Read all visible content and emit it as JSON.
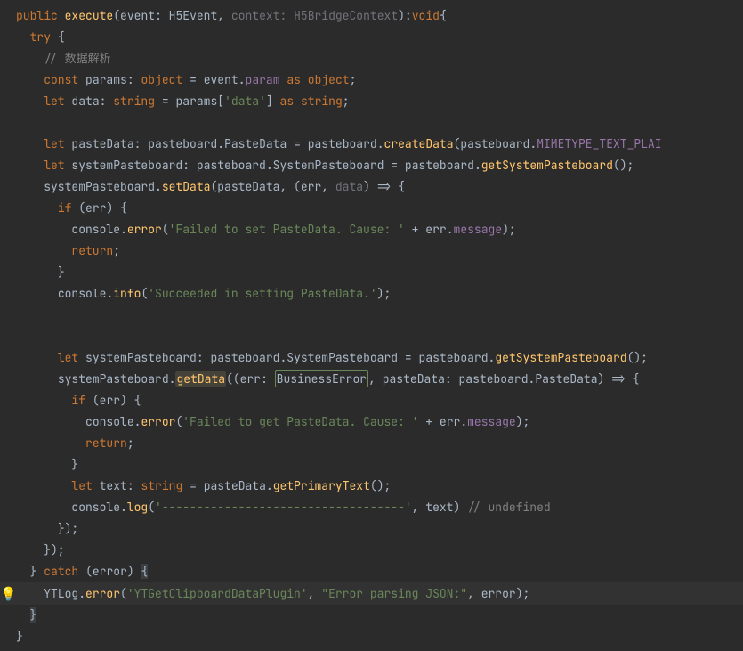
{
  "code": {
    "kw_public": "public",
    "fn_execute": "execute",
    "p_event": "event",
    "t_H5Event": "H5Event",
    "p_context": "context",
    "t_H5BridgeContext": "H5BridgeContext",
    "t_void": "void",
    "kw_try": "try",
    "cmt_parse": "// 数据解析",
    "kw_const": "const",
    "id_params": "params",
    "t_object": "object",
    "id_event": "event",
    "prop_param": "param",
    "kw_as": "as",
    "kw_let": "let",
    "id_data": "data",
    "t_string": "string",
    "str_data": "'data'",
    "id_pasteData": "pasteData",
    "ns_pasteboard": "pasteboard",
    "t_PasteData": "PasteData",
    "fn_createData": "createData",
    "prop_MIMETYPE": "MIMETYPE_TEXT_PLAI",
    "id_systemPasteboard": "systemPasteboard",
    "t_SystemPasteboard": "SystemPasteboard",
    "fn_getSystemPasteboard": "getSystemPasteboard",
    "fn_setData": "setData",
    "p_err": "err",
    "p_data_faded": "data",
    "kw_if": "if",
    "id_console": "console",
    "fn_error": "error",
    "str_failSet": "'Failed to set PasteData. Cause: '",
    "id_err": "err",
    "prop_message": "message",
    "kw_return": "return",
    "fn_info": "info",
    "str_succ": "'Succeeded in setting PasteData.'",
    "fn_getData": "getData",
    "t_BusinessError": "BusinessError",
    "str_failGet": "'Failed to get PasteData. Cause: '",
    "id_text": "text",
    "fn_getPrimaryText": "getPrimaryText",
    "fn_log": "log",
    "str_dashes": "'-----------------------------------'",
    "cmt_undef": "// undefined",
    "kw_catch": "catch",
    "id_error": "error",
    "id_YTLog": "YTLog",
    "str_plugin": "'YTGetClipboardDataPlugin'",
    "str_errjson": "\"Error parsing JSON:\""
  }
}
